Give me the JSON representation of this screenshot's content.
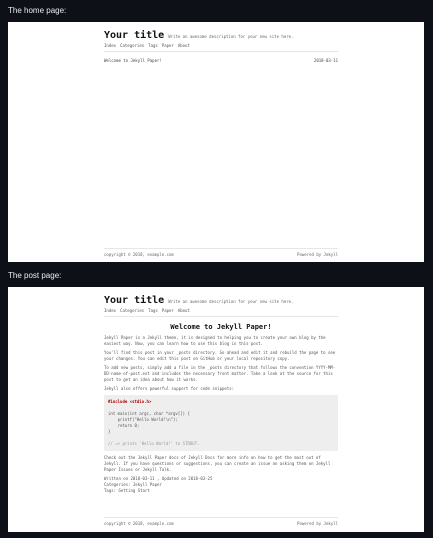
{
  "labels": {
    "home": "The home page:",
    "post": "The post page:"
  },
  "site": {
    "title": "Your title",
    "description": "Write an awesome description for your new site here.",
    "nav": [
      "Index",
      "Categories",
      "Tags",
      "Paper",
      "About"
    ],
    "footer_left": "copyright © 2018, example.com",
    "footer_right": "Powered by Jekyll"
  },
  "home": {
    "post_link": "Welcome to Jekyll Paper!",
    "post_date": "2018-03-11"
  },
  "post": {
    "title": "Welcome to Jekyll Paper!",
    "paragraphs": [
      "Jekyll Paper is a Jekyll theme, it is designed to helping you to create your own blog by the easiest way. Now, you can learn how to use this blog in this post.",
      "You'll find this post in your _posts directory. Go ahead and edit it and rebuild the page to see your changes. You can edit this post on GitHub or your local repository copy.",
      "To add new posts, simply add a file in the _posts directory that follows the convention YYYY-MM-DD-name-of-post.ext and includes the necessary front matter. Take a look at the source for this post to get an idea about how it works.",
      "Jekyll also offers powerful support for code snippets:"
    ],
    "code_lines": [
      "#include <stdio.h>",
      "",
      "int main(int argc, char *argv[]) {",
      "    printf(\"Hello World!\\n\");",
      "    return 0;",
      "}",
      "",
      "// => prints 'Hello World!' to STDOUT."
    ],
    "after_code": "Check out the Jekyll Paper docs of Jekyll Docs for more info on how to get the most out of Jekyll. If you have questions or suggestions, you can create an issue on asking them on Jekyll Paper Issues or Jekyll Talk.",
    "written_on": "Written on 2018-03-11 , Updated on 2018-03-25",
    "categories": "Categories: Jekyll Paper",
    "tags": "Tags: Getting Start"
  }
}
